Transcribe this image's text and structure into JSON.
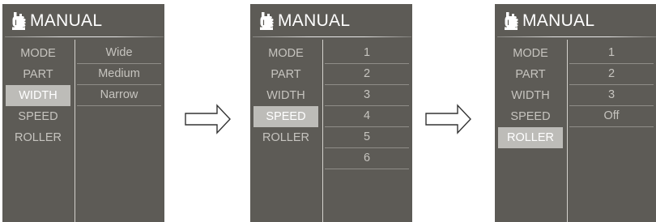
{
  "panels": [
    {
      "title": "MANUAL",
      "icon": "thumbs-up-icon",
      "menu": [
        "MODE",
        "PART",
        "WIDTH",
        "SPEED",
        "ROLLER"
      ],
      "selected": "WIDTH",
      "options": [
        "Wide",
        "Medium",
        "Narrow"
      ]
    },
    {
      "title": "MANUAL",
      "icon": "thumbs-up-icon",
      "menu": [
        "MODE",
        "PART",
        "WIDTH",
        "SPEED",
        "ROLLER"
      ],
      "selected": "SPEED",
      "options": [
        "1",
        "2",
        "3",
        "4",
        "5",
        "6"
      ]
    },
    {
      "title": "MANUAL",
      "icon": "thumbs-up-icon",
      "menu": [
        "MODE",
        "PART",
        "WIDTH",
        "SPEED",
        "ROLLER"
      ],
      "selected": "ROLLER",
      "options": [
        "1",
        "2",
        "3",
        "Off"
      ]
    }
  ],
  "colors": {
    "panel_bg": "#5d5b56",
    "selected_bg": "#bdbcb8",
    "text": "#c6c4bf",
    "title": "#ffffff"
  }
}
